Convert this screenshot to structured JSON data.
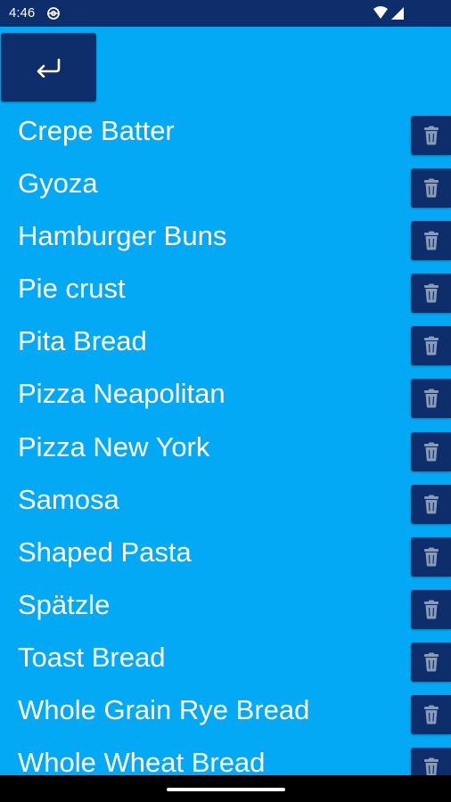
{
  "status_bar": {
    "time": "4:46",
    "icons": [
      "vpn-icon",
      "wifi-icon",
      "signal-icon"
    ]
  },
  "toolbar": {
    "back_icon": "return-arrow-icon"
  },
  "recipes": {
    "items": [
      "Crepe Batter",
      "Gyoza",
      "Hamburger Buns",
      "Pie crust",
      "Pita Bread",
      "Pizza Neapolitan",
      "Pizza New York",
      "Samosa",
      "Shaped Pasta",
      "Spätzle",
      "Toast Bread",
      "Whole Grain Rye Bread",
      "Whole Wheat Bread"
    ],
    "delete_icon": "trash-icon"
  },
  "colors": {
    "background": "#03A9F4",
    "bar": "#0D2D6B",
    "button": "#0D2D6B",
    "text": "#FFFFFF",
    "icon": "#8A9BB8"
  }
}
